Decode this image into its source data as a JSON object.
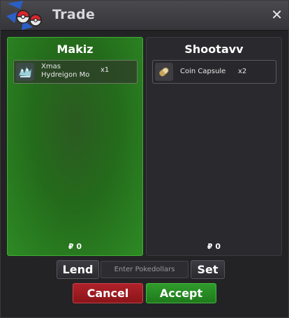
{
  "window": {
    "title": "Trade",
    "close_glyph": "✕"
  },
  "trade": {
    "left": {
      "name": "Makiz",
      "items": [
        {
          "name": "Xmas Hydreigon Mo",
          "quantity": "x1",
          "icon": "hydreigon-plush-icon"
        }
      ],
      "money": "₽ 0"
    },
    "right": {
      "name": "Shootavv",
      "items": [
        {
          "name": "Coin Capsule",
          "quantity": "x2",
          "icon": "coin-capsule-icon"
        }
      ],
      "money": "₽ 0"
    }
  },
  "controls": {
    "lend_label": "Lend",
    "pokedollars_placeholder": "Enter Pokedollars",
    "set_label": "Set",
    "cancel_label": "Cancel",
    "accept_label": "Accept"
  },
  "colors": {
    "accept": "#2f9b2b",
    "cancel": "#b0222a",
    "own_panel": "#2d8a24"
  }
}
